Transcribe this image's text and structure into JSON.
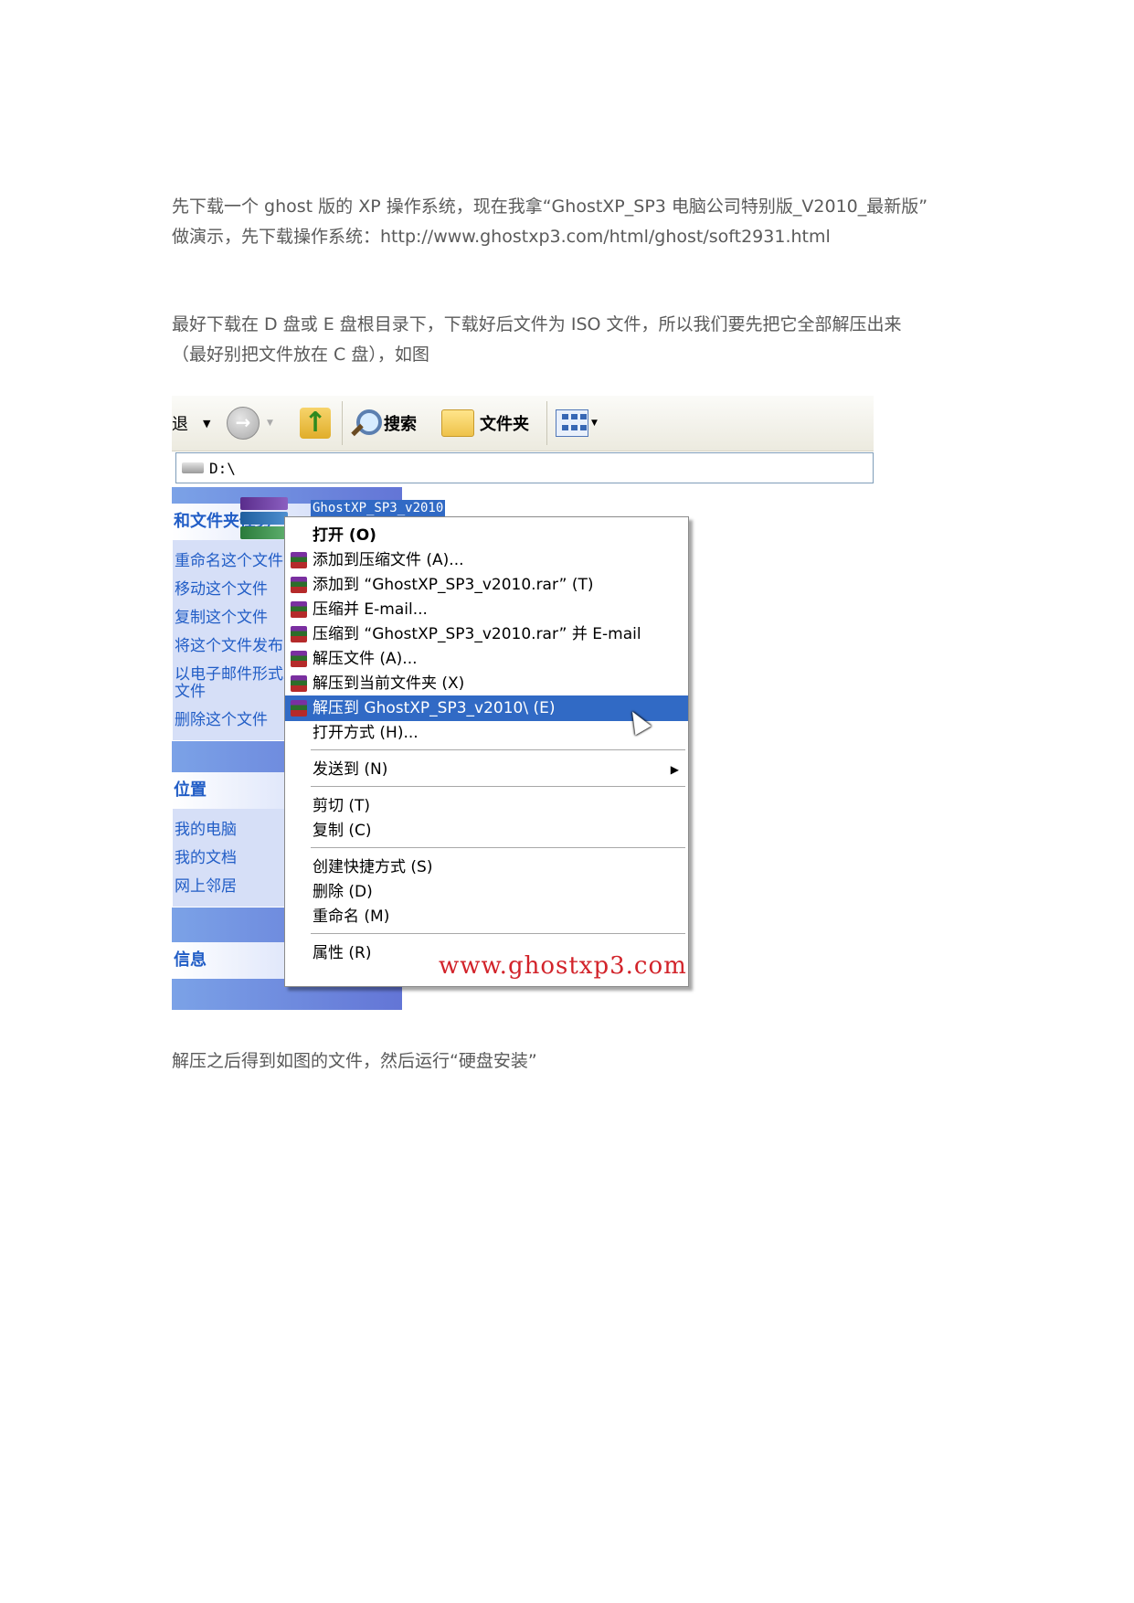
{
  "paragraphs": {
    "p1_line1": "先下载一个 ghost 版的 XP 操作系统，现在我拿“GhostXP_SP3 电脑公司特别版_V2010_最新版”",
    "p1_line2": "做演示，先下载操作系统：http://www.ghostxp3.com/html/ghost/soft2931.html",
    "p2_line1": "最好下载在 D 盘或 E 盘根目录下，下载好后文件为 ISO 文件，所以我们要先把它全部解压出来",
    "p2_line2": "（最好别把文件放在 C 盘），如图",
    "p3": "解压之后得到如图的文件，然后运行“硬盘安装”"
  },
  "screenshot": {
    "toolbar": {
      "back_label": "退",
      "search_label": "搜索",
      "folders_label": "文件夹"
    },
    "address": "D:\\",
    "left_panels": {
      "tasks": {
        "title": "和文件夹任务",
        "items": [
          "重命名这个文件",
          "移动这个文件",
          "复制这个文件",
          "将这个文件发布到 Web",
          "以电子邮件形式发送此",
          "文件",
          "删除这个文件"
        ]
      },
      "places": {
        "title": "位置",
        "items": [
          "我的电脑",
          "我的文档",
          "网上邻居"
        ]
      },
      "details": {
        "title": "信息"
      }
    },
    "file_name": "GhostXP_SP3_v2010",
    "context_menu": [
      "打开 (O)",
      "添加到压缩文件 (A)...",
      "添加到 “GhostXP_SP3_v2010.rar” (T)",
      "压缩并 E-mail...",
      "压缩到 “GhostXP_SP3_v2010.rar” 并 E-mail",
      "解压文件 (A)...",
      "解压到当前文件夹 (X)",
      "解压到 GhostXP_SP3_v2010\\ (E)",
      "打开方式 (H)...",
      "发送到 (N)",
      "剪切 (T)",
      "复制 (C)",
      "创建快捷方式 (S)",
      "删除 (D)",
      "重命名 (M)",
      "属性 (R)"
    ],
    "watermark": "www.ghostxp3.com"
  },
  "colors": {
    "xp_blue": "#316ac5",
    "task_link": "#215dc6",
    "watermark_red": "#d2232a"
  }
}
